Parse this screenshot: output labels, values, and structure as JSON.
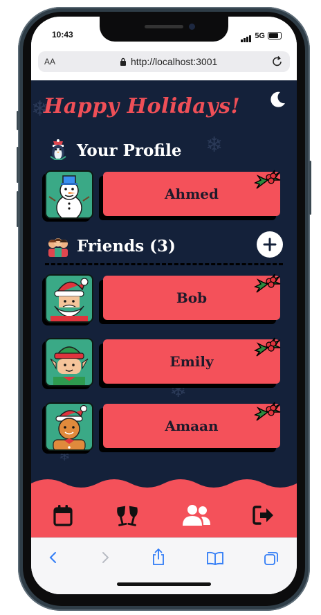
{
  "status": {
    "time": "10:43",
    "network": "5G"
  },
  "browser": {
    "text_size_label": "AA",
    "url": "http://localhost:3001"
  },
  "app": {
    "title": "Happy Holidays!",
    "profile": {
      "heading": "Your Profile",
      "name": "Ahmed"
    },
    "friends": {
      "heading": "Friends (3)",
      "items": [
        {
          "name": "Bob",
          "avatar": "santa-avatar"
        },
        {
          "name": "Emily",
          "avatar": "elf-avatar"
        },
        {
          "name": "Amaan",
          "avatar": "gingerbread-avatar"
        }
      ]
    },
    "colors": {
      "background": "#14213a",
      "accent": "#f4515a",
      "avatar_bg": "#3aa986"
    }
  },
  "nav": {
    "items": [
      {
        "icon": "calendar-icon"
      },
      {
        "icon": "cheers-icon"
      },
      {
        "icon": "friends-icon",
        "active": true
      },
      {
        "icon": "logout-icon"
      }
    ]
  },
  "safari_toolbar": [
    "back-icon",
    "forward-icon",
    "share-icon",
    "bookmarks-icon",
    "tabs-icon"
  ]
}
